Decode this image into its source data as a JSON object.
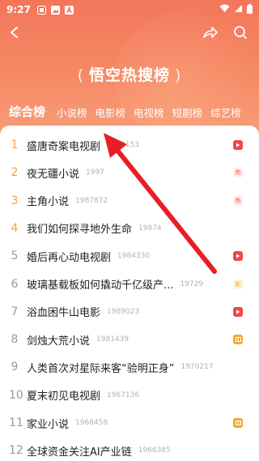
{
  "status_bar": {
    "time": "9:27"
  },
  "header": {
    "title": "悟空热搜榜",
    "left_paren": "(",
    "right_paren": ")"
  },
  "tabs": [
    {
      "label": "综合榜",
      "active": true
    },
    {
      "label": "小说榜"
    },
    {
      "label": "电影榜"
    },
    {
      "label": "电视榜"
    },
    {
      "label": "短剧榜"
    },
    {
      "label": "综艺榜"
    }
  ],
  "list": [
    {
      "rank": "1",
      "title": "盛唐奇案电视剧",
      "count": "1991153",
      "badge": "video",
      "badge_text": ""
    },
    {
      "rank": "2",
      "title": "夜无疆小说",
      "count": "1997",
      "badge": "hot",
      "badge_text": "热"
    },
    {
      "rank": "3",
      "title": "主角小说",
      "count": "1987872",
      "badge": "hot",
      "badge_text": "热"
    },
    {
      "rank": "4",
      "title": "我们如何探寻地外生命",
      "count": "19874",
      "badge": "",
      "badge_text": ""
    },
    {
      "rank": "5",
      "title": "婚后再心动电视剧",
      "count": "1984330",
      "badge": "video",
      "badge_text": ""
    },
    {
      "rank": "6",
      "title": "玻璃基载板如何撬动千亿级产...",
      "count": "19729",
      "badge": "new",
      "badge_text": "新"
    },
    {
      "rank": "7",
      "title": "浴血困牛山电影",
      "count": "1989023",
      "badge": "video",
      "badge_text": ""
    },
    {
      "rank": "8",
      "title": "剑烛大荒小说",
      "count": "1981439",
      "badge": "book",
      "badge_text": ""
    },
    {
      "rank": "9",
      "title": "人类首次对星际来客“验明正身”",
      "count": "1970217",
      "badge": "",
      "badge_text": ""
    },
    {
      "rank": "10",
      "title": "夏末初见电视剧",
      "count": "1967136",
      "badge": "",
      "badge_text": ""
    },
    {
      "rank": "11",
      "title": "家业小说",
      "count": "1968458",
      "badge": "book",
      "badge_text": ""
    },
    {
      "rank": "12",
      "title": "全球资金关注AI产业链",
      "count": "1966385",
      "badge": "",
      "badge_text": ""
    }
  ],
  "colors": {
    "header_gradient_top": "#f4765a",
    "header_gradient_bottom": "#f7a07a",
    "rank_top": "#f7a23b",
    "rank_normal": "#9a9a9a",
    "annotation_arrow": "#e81e25"
  }
}
